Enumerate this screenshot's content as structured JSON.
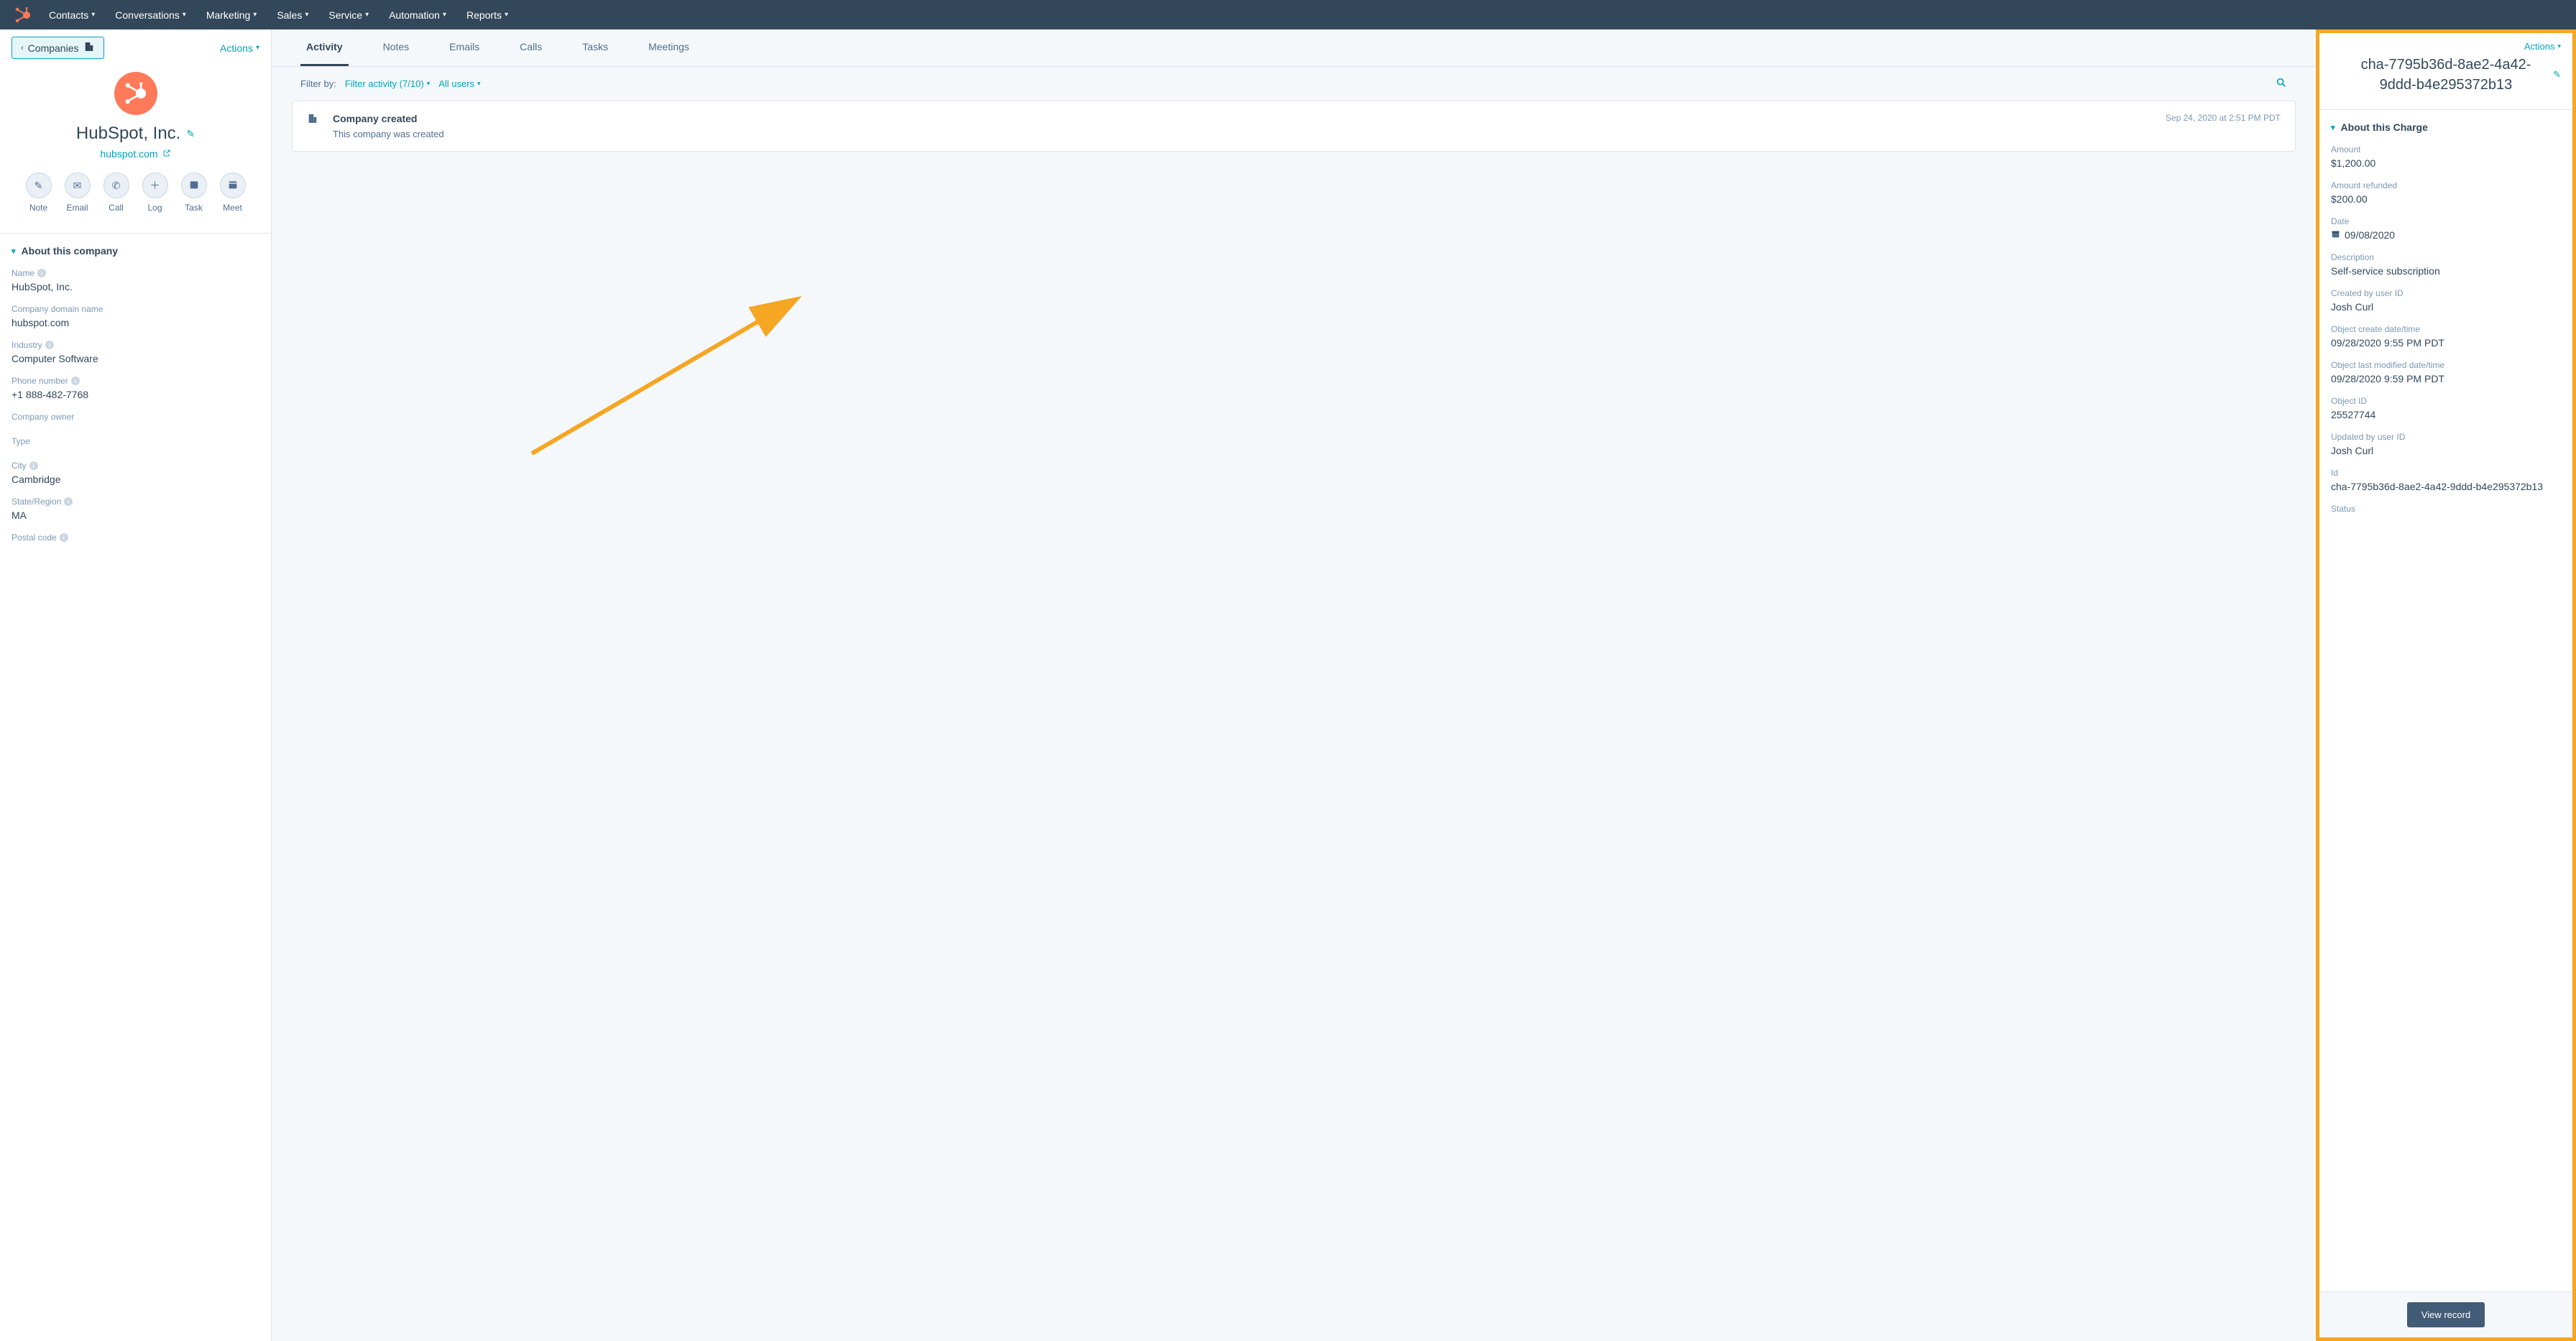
{
  "topnav": {
    "items": [
      "Contacts",
      "Conversations",
      "Marketing",
      "Sales",
      "Service",
      "Automation",
      "Reports"
    ]
  },
  "left": {
    "back_label": "Companies",
    "actions_label": "Actions",
    "company_name": "HubSpot, Inc.",
    "company_domain": "hubspot.com",
    "actions": [
      {
        "label": "Note"
      },
      {
        "label": "Email"
      },
      {
        "label": "Call"
      },
      {
        "label": "Log"
      },
      {
        "label": "Task"
      },
      {
        "label": "Meet"
      }
    ],
    "section_title": "About this company",
    "props": [
      {
        "label": "Name",
        "value": "HubSpot, Inc.",
        "info": true
      },
      {
        "label": "Company domain name",
        "value": "hubspot.com",
        "info": false
      },
      {
        "label": "Industry",
        "value": "Computer Software",
        "info": true
      },
      {
        "label": "Phone number",
        "value": "+1 888-482-7768",
        "info": true
      },
      {
        "label": "Company owner",
        "value": "",
        "info": false
      },
      {
        "label": "Type",
        "value": "",
        "info": false
      },
      {
        "label": "City",
        "value": "Cambridge",
        "info": true
      },
      {
        "label": "State/Region",
        "value": "MA",
        "info": true
      },
      {
        "label": "Postal code",
        "value": "",
        "info": true
      }
    ]
  },
  "center": {
    "tabs": [
      "Activity",
      "Notes",
      "Emails",
      "Calls",
      "Tasks",
      "Meetings"
    ],
    "filter_label": "Filter by:",
    "filter_activity": "Filter activity (7/10)",
    "filter_users": "All users",
    "activity": {
      "title": "Company created",
      "desc": "This company was created",
      "timestamp": "Sep 24, 2020 at 2:51 PM PDT"
    }
  },
  "right": {
    "actions_label": "Actions",
    "title": "cha-7795b36d-8ae2-4a42-9ddd-b4e295372b13",
    "section_title": "About this Charge",
    "props": [
      {
        "label": "Amount",
        "value": "$1,200.00"
      },
      {
        "label": "Amount refunded",
        "value": "$200.00"
      },
      {
        "label": "Date",
        "value": "09/08/2020",
        "icon": "calendar"
      },
      {
        "label": "Description",
        "value": "Self-service subscription"
      },
      {
        "label": "Created by user ID",
        "value": "Josh Curl"
      },
      {
        "label": "Object create date/time",
        "value": "09/28/2020 9:55 PM PDT"
      },
      {
        "label": "Object last modified date/time",
        "value": "09/28/2020 9:59 PM PDT"
      },
      {
        "label": "Object ID",
        "value": "25527744"
      },
      {
        "label": "Updated by user ID",
        "value": "Josh Curl"
      },
      {
        "label": "Id",
        "value": "cha-7795b36d-8ae2-4a42-9ddd-b4e295372b13"
      },
      {
        "label": "Status",
        "value": ""
      }
    ],
    "view_record": "View record"
  },
  "colors": {
    "accent": "#00a4bd",
    "orange": "#ff7a59",
    "highlight_border": "#f5a623"
  }
}
